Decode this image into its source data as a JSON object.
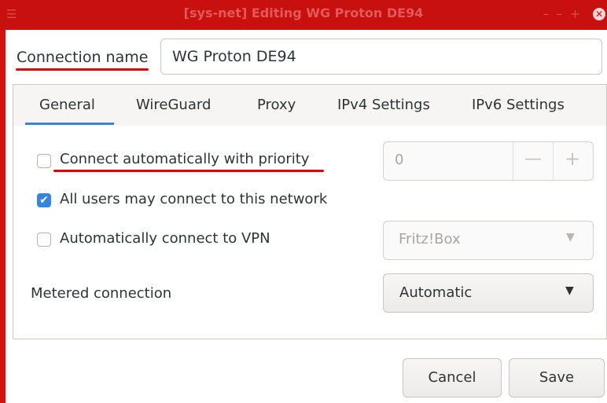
{
  "window": {
    "title": "[sys-net] Editing WG Proton DE94",
    "menu_icon": "hamburger-icon",
    "controls": "– – +",
    "close_icon": "close-icon",
    "close_glyph": "✕"
  },
  "connection_name": {
    "label": "Connection name",
    "value": "WG Proton DE94"
  },
  "tabs": [
    {
      "label": "General",
      "active": true
    },
    {
      "label": "WireGuard",
      "active": false
    },
    {
      "label": "Proxy",
      "active": false
    },
    {
      "label": "IPv4 Settings",
      "active": false
    },
    {
      "label": "IPv6 Settings",
      "active": false
    }
  ],
  "general": {
    "auto_connect": {
      "label": "Connect automatically with priority",
      "checked": false
    },
    "priority": {
      "value": "0",
      "minus": "—",
      "plus": "+"
    },
    "all_users": {
      "label": "All users may connect to this network",
      "checked": true,
      "check_glyph": "✔"
    },
    "auto_vpn": {
      "label": "Automatically connect to VPN",
      "checked": false
    },
    "vpn_select": {
      "value": "Fritz!Box"
    },
    "metered": {
      "label": "Metered connection",
      "value": "Automatic"
    },
    "arrow_glyph": "▼"
  },
  "buttons": {
    "cancel": "Cancel",
    "save": "Save"
  },
  "colors": {
    "titlebar": "#c8100f",
    "accent": "#3584e4",
    "annotation": "#e00000"
  }
}
